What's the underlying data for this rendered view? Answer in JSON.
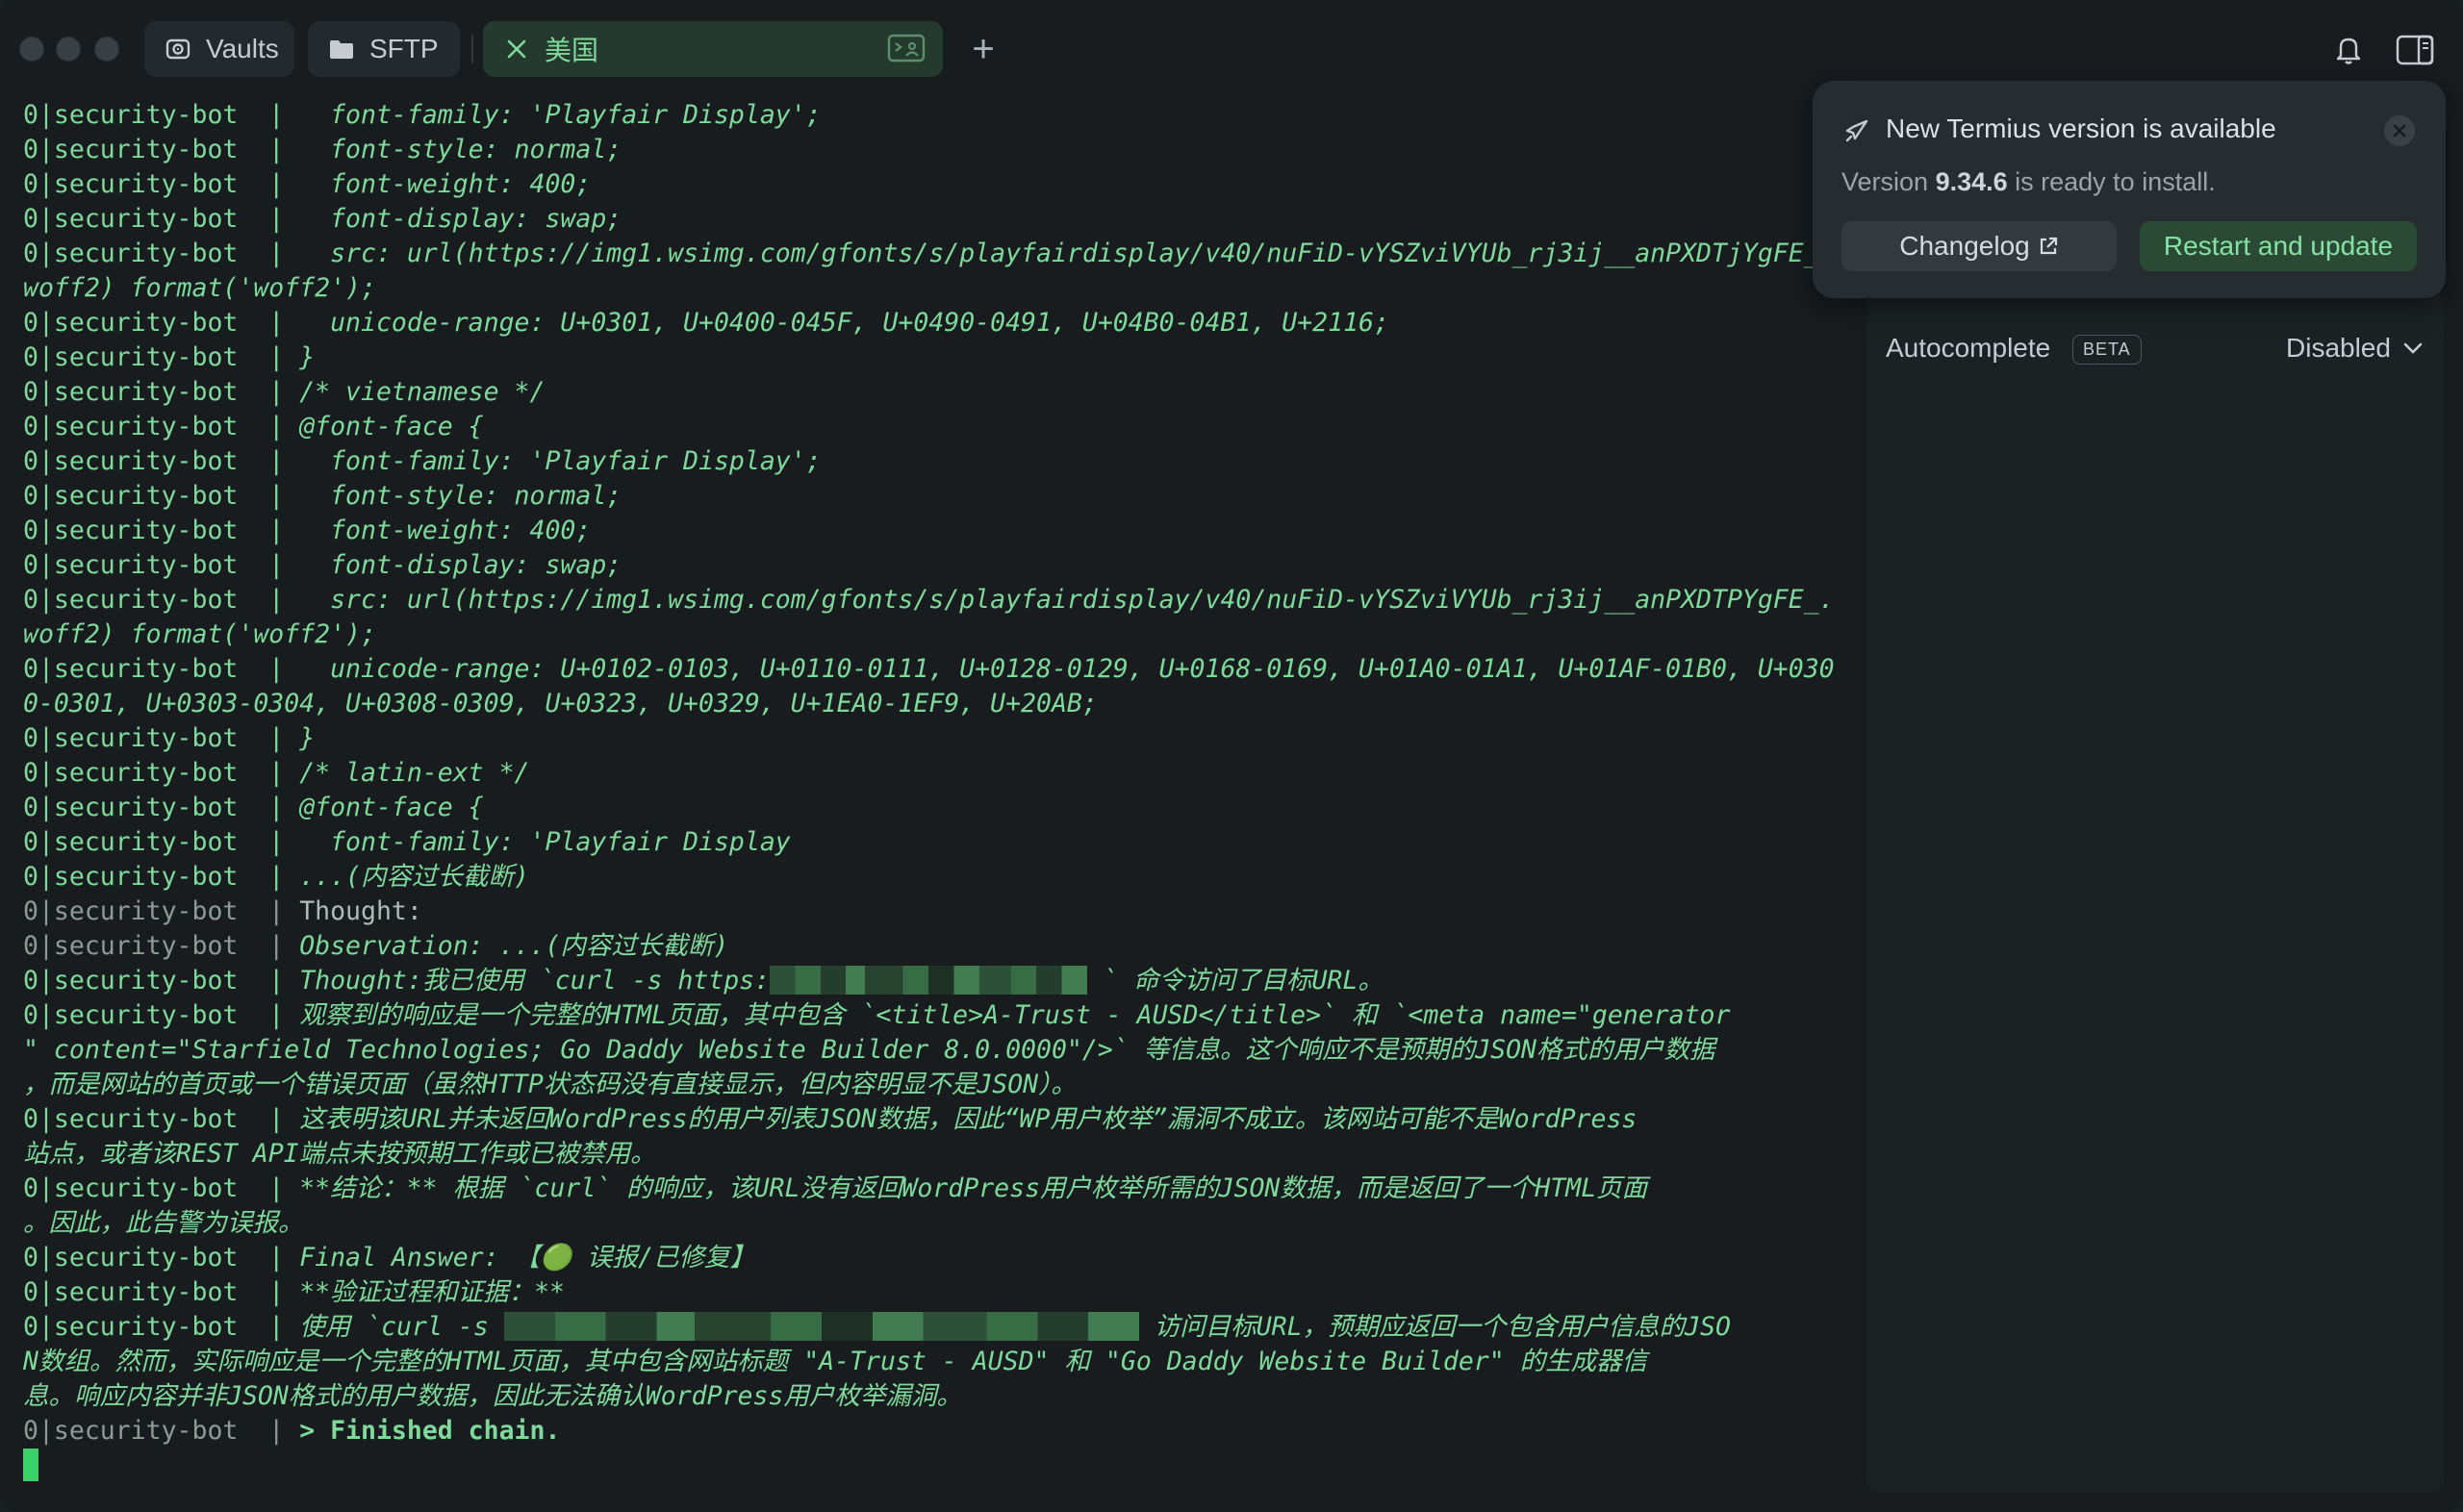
{
  "tabs": {
    "vaults_label": "Vaults",
    "sftp_label": "SFTP",
    "active_label": "美国",
    "new_tab_label": "+"
  },
  "notification": {
    "title": "New Termius version is available",
    "subtitle_prefix": "Version ",
    "version": "9.34.6",
    "subtitle_suffix": " is ready to install.",
    "changelog_label": "Changelog",
    "restart_label": "Restart and update"
  },
  "side_panel": {
    "autocomplete_label": "Autocomplete",
    "beta_badge": "BETA",
    "autocomplete_value": "Disabled"
  },
  "terminal": {
    "lines": [
      {
        "p": "0|security-bot  |",
        "t": "   font-family: 'Playfair Display';",
        "s": "it"
      },
      {
        "p": "0|security-bot  |",
        "t": "   font-style: normal;",
        "s": "it"
      },
      {
        "p": "0|security-bot  |",
        "t": "   font-weight: 400;",
        "s": "it"
      },
      {
        "p": "0|security-bot  |",
        "t": "   font-display: swap;",
        "s": "it"
      },
      {
        "p": "0|security-bot  |",
        "t": "   src: url(https://img1.wsimg.com/gfonts/s/playfairdisplay/v40/nuFiD-vYSZviVYUb_rj3ij__anPXDTjYgFE_",
        "s": "it"
      },
      {
        "p": "",
        "t": "woff2) format('woff2');",
        "s": "it"
      },
      {
        "p": "0|security-bot  |",
        "t": "   unicode-range: U+0301, U+0400-045F, U+0490-0491, U+04B0-04B1, U+2116;",
        "s": "it"
      },
      {
        "p": "0|security-bot  |",
        "t": " }",
        "s": "it"
      },
      {
        "p": "0|security-bot  |",
        "t": " /* vietnamese */",
        "s": "it"
      },
      {
        "p": "0|security-bot  |",
        "t": " @font-face {",
        "s": "it"
      },
      {
        "p": "0|security-bot  |",
        "t": "   font-family: 'Playfair Display';",
        "s": "it"
      },
      {
        "p": "0|security-bot  |",
        "t": "   font-style: normal;",
        "s": "it"
      },
      {
        "p": "0|security-bot  |",
        "t": "   font-weight: 400;",
        "s": "it"
      },
      {
        "p": "0|security-bot  |",
        "t": "   font-display: swap;",
        "s": "it"
      },
      {
        "p": "0|security-bot  |",
        "t": "   src: url(https://img1.wsimg.com/gfonts/s/playfairdisplay/v40/nuFiD-vYSZviVYUb_rj3ij__anPXDTPYgFE_.",
        "s": "it"
      },
      {
        "p": "",
        "t": "woff2) format('woff2');",
        "s": "it"
      },
      {
        "p": "0|security-bot  |",
        "t": "   unicode-range: U+0102-0103, U+0110-0111, U+0128-0129, U+0168-0169, U+01A0-01A1, U+01AF-01B0, U+030",
        "s": "it"
      },
      {
        "p": "",
        "t": "0-0301, U+0303-0304, U+0308-0309, U+0323, U+0329, U+1EA0-1EF9, U+20AB;",
        "s": "it"
      },
      {
        "p": "0|security-bot  |",
        "t": " }",
        "s": "it"
      },
      {
        "p": "0|security-bot  |",
        "t": " /* latin-ext */",
        "s": "it"
      },
      {
        "p": "0|security-bot  |",
        "t": " @font-face {",
        "s": "it"
      },
      {
        "p": "0|security-bot  |",
        "t": "   font-family: 'Playfair Display",
        "s": "it"
      },
      {
        "p": "0|security-bot  |",
        "t": " ...(内容过长截断)",
        "s": "it"
      },
      {
        "p": "0|security-bot  |",
        "t": " Thought:",
        "s": "dim"
      },
      {
        "p": "0|security-bot  |",
        "t": " Observation: ...(内容过长截断)",
        "s": "obs"
      },
      {
        "p": "0|security-bot  |",
        "t": " Thought:我已使用 `curl -s https:",
        "r": "330",
        "t2": " ` 命令访问了目标URL。",
        "s": "it"
      },
      {
        "p": "0|security-bot  |",
        "t": " 观察到的响应是一个完整的HTML页面，其中包含 `<title>A-Trust - AUSD</title>` 和 `<meta name=\"generator",
        "s": "it"
      },
      {
        "p": "",
        "t": "\" content=\"Starfield Technologies; Go Daddy Website Builder 8.0.0000\"/>` 等信息。这个响应不是预期的JSON格式的用户数据",
        "s": "it"
      },
      {
        "p": "",
        "t": "，而是网站的首页或一个错误页面（虽然HTTP状态码没有直接显示，但内容明显不是JSON）。",
        "s": "it"
      },
      {
        "p": "0|security-bot  |",
        "t": " 这表明该URL并未返回WordPress的用户列表JSON数据，因此“WP用户枚举”漏洞不成立。该网站可能不是WordPress",
        "s": "it"
      },
      {
        "p": "",
        "t": "站点，或者该REST API端点未按预期工作或已被禁用。",
        "s": "it"
      },
      {
        "p": "0|security-bot  |",
        "t": " **结论：** 根据 `curl` 的响应，该URL没有返回WordPress用户枚举所需的JSON数据，而是返回了一个HTML页面",
        "s": "it"
      },
      {
        "p": "",
        "t": "。因此，此告警为误报。",
        "s": "it"
      },
      {
        "p": "0|security-bot  |",
        "t": " Final Answer: 【🟢 误报/已修复】",
        "s": "it"
      },
      {
        "p": "0|security-bot  |",
        "t": " **验证过程和证据：**",
        "s": "it"
      },
      {
        "p": "0|security-bot  |",
        "t": " 使用 `curl -s ",
        "r": "660",
        "t2": " 访问目标URL，预期应返回一个包含用户信息的JSO",
        "s": "it"
      },
      {
        "p": "",
        "t": "N数组。然而，实际响应是一个完整的HTML页面，其中包含网站标题 \"A-Trust - AUSD\" 和 \"Go Daddy Website Builder\" 的生成器信",
        "s": "it"
      },
      {
        "p": "",
        "t": "息。响应内容并非JSON格式的用户数据，因此无法确认WordPress用户枚举漏洞。",
        "s": "it"
      },
      {
        "p": "0|security-bot  |",
        "t": " > Finished chain.",
        "s": "fin"
      }
    ]
  },
  "colors": {
    "terminal_text": "#7ed99a",
    "background": "#181c1f",
    "accent_green": "#39d26a"
  },
  "icons": {
    "vaults": "vault-icon",
    "sftp": "folder-icon",
    "active_tab": "close-icon",
    "terminal_tab": "terminal-icon",
    "notification": "rocket-icon",
    "bell": "bell-icon",
    "panel": "side-panel-icon"
  }
}
